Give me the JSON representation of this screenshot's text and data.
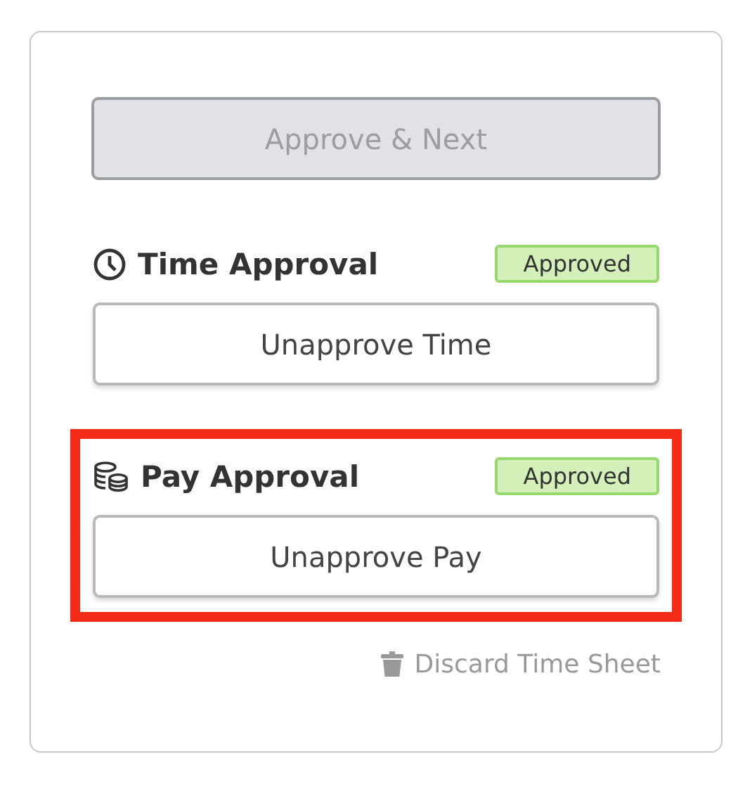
{
  "primary_button": {
    "label": "Approve & Next",
    "disabled": true
  },
  "sections": [
    {
      "kind": "time",
      "title": "Time Approval",
      "badge": "Approved",
      "button": "Unapprove Time",
      "highlighted": false
    },
    {
      "kind": "pay",
      "title": "Pay Approval",
      "badge": "Approved",
      "button": "Unapprove Pay",
      "highlighted": true
    }
  ],
  "discard_link": "Discard Time Sheet"
}
